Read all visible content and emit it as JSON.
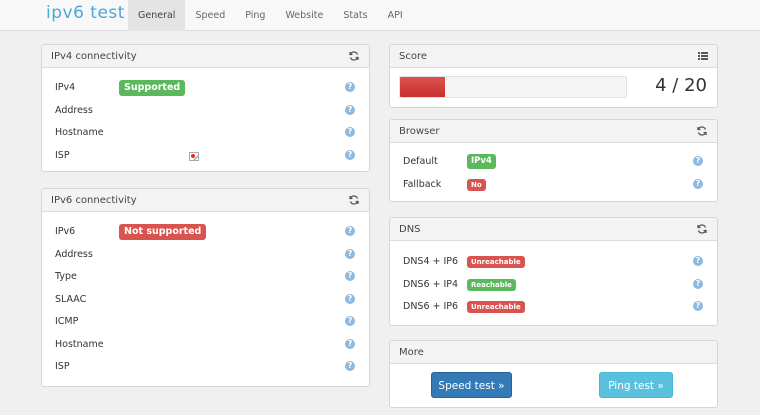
{
  "brand": "ipv6 test",
  "nav": [
    "General",
    "Speed",
    "Ping",
    "Website",
    "Stats",
    "API"
  ],
  "ipv4_panel": {
    "title": "IPv4 connectivity",
    "rows": [
      {
        "label": "IPv4",
        "badge": "Supported"
      },
      {
        "label": "Address"
      },
      {
        "label": "Hostname"
      },
      {
        "label": "ISP"
      }
    ]
  },
  "ipv6_panel": {
    "title": "IPv6 connectivity",
    "rows": [
      {
        "label": "IPv6",
        "badge": "Not supported"
      },
      {
        "label": "Address"
      },
      {
        "label": "Type"
      },
      {
        "label": "SLAAC"
      },
      {
        "label": "ICMP"
      },
      {
        "label": "Hostname"
      },
      {
        "label": "ISP"
      }
    ]
  },
  "score_panel": {
    "title": "Score",
    "score_text": "4 / 20",
    "score_value": 4,
    "score_max": 20
  },
  "browser_panel": {
    "title": "Browser",
    "rows": [
      {
        "label": "Default",
        "badge": "IPv4"
      },
      {
        "label": "Fallback",
        "badge": "No"
      }
    ]
  },
  "dns_panel": {
    "title": "DNS",
    "rows": [
      {
        "label": "DNS4 + IP6",
        "badge": "Unreachable"
      },
      {
        "label": "DNS6 + IP4",
        "badge": "Reachable"
      },
      {
        "label": "DNS6 + IP6",
        "badge": "Unreachable"
      }
    ]
  },
  "more_panel": {
    "title": "More",
    "speed_button": "Speed test »",
    "ping_button": "Ping test »"
  },
  "help_glyph": "?",
  "colors": {
    "brand": "#4aa8d8",
    "success": "#5cb85c",
    "danger": "#d9534f",
    "primary": "#337ab7",
    "info": "#5bc0de",
    "help": "#8db9e0"
  }
}
